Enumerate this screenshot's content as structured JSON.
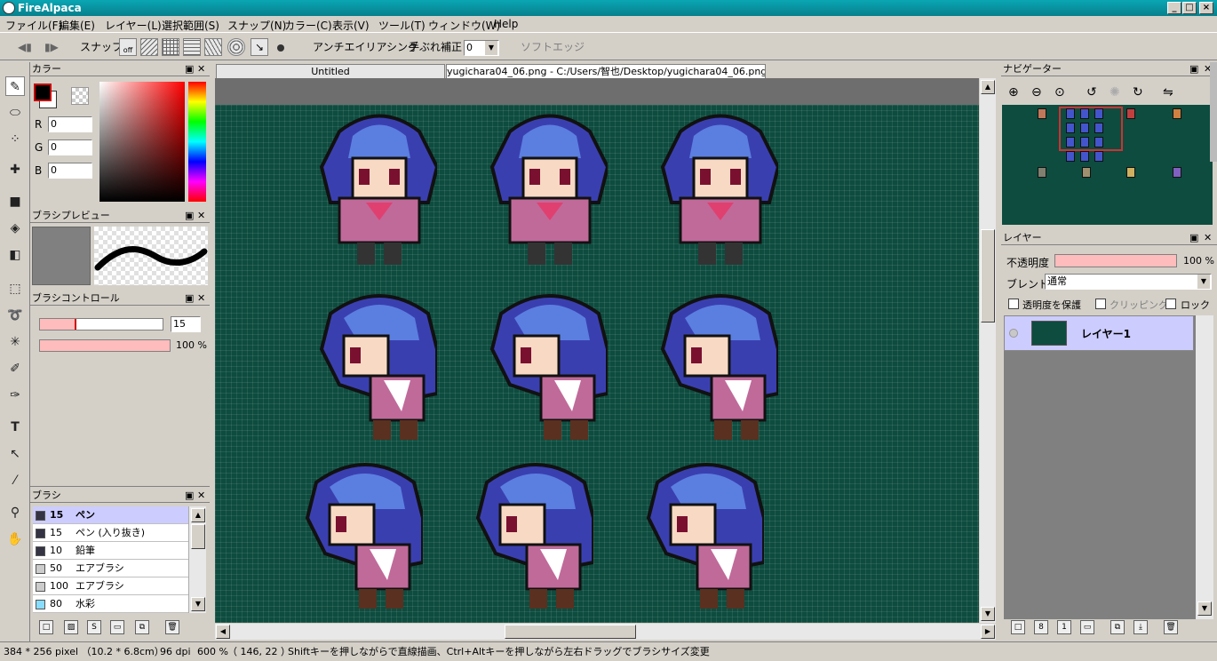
{
  "window": {
    "title": "FireAlpaca"
  },
  "menu": [
    "ファイル(F)",
    "編集(E)",
    "レイヤー(L)",
    "選択範囲(S)",
    "スナップ(N)",
    "カラー(C)",
    "表示(V)",
    "ツール(T)",
    "ウィンドウ(W)",
    "Help"
  ],
  "toolbar": {
    "snap_label": "スナップ",
    "snap_off": "off",
    "antialias_label": "アンチエイリアシング",
    "antialias_checked": "✓",
    "stabilizer_label": "手ぶれ補正",
    "stabilizer_value": "0",
    "soft_edge_label": "ソフトエッジ"
  },
  "tabs": [
    {
      "label": "Untitled"
    },
    {
      "label": "yugichara04_06.png - C:/Users/智也/Desktop/yugichara04_06.png"
    }
  ],
  "color_panel": {
    "title": "カラー",
    "r_label": "R",
    "r_value": "0",
    "g_label": "G",
    "g_value": "0",
    "b_label": "B",
    "b_value": "0",
    "fg_color": "#000000",
    "bg_color": "#ffffff"
  },
  "brush_preview": {
    "title": "ブラシプレビュー"
  },
  "brush_control": {
    "title": "ブラシコントロール",
    "size_value": "15",
    "opacity_value": "100 %"
  },
  "brush_panel": {
    "title": "ブラシ",
    "items": [
      {
        "size": "15",
        "name": "ペン",
        "swatch": "#333344",
        "selected": true
      },
      {
        "size": "15",
        "name": "ペン (入り抜き)",
        "swatch": "#333344",
        "selected": false
      },
      {
        "size": "10",
        "name": "鉛筆",
        "swatch": "#333344",
        "selected": false
      },
      {
        "size": "50",
        "name": "エアブラシ",
        "swatch": "#cccccc",
        "selected": false
      },
      {
        "size": "100",
        "name": "エアブラシ",
        "swatch": "#cccccc",
        "selected": false
      },
      {
        "size": "80",
        "name": "水彩",
        "swatch": "#88ddff",
        "selected": false
      }
    ]
  },
  "navigator": {
    "title": "ナビゲーター"
  },
  "layer_panel": {
    "title": "レイヤー",
    "opacity_label": "不透明度",
    "opacity_value": "100 %",
    "blend_label": "ブレンド",
    "blend_value": "通常",
    "protect_alpha_label": "透明度を保護",
    "clipping_label": "クリッピング",
    "lock_label": "ロック",
    "layers": [
      {
        "name": "レイヤー1"
      }
    ]
  },
  "status": {
    "size": "384 * 256 pixel （10.2 * 6.8cm）",
    "dpi": "96 dpi",
    "zoom": "600 %",
    "coords": "（ 146, 22 ）",
    "hint": "Shiftキーを押しながらで直線描画、Ctrl+Altキーを押しながら左右ドラッグでブラシサイズ変更"
  },
  "colors": {
    "canvas_bg": "#0d4c3f",
    "title_bar": "#0aa6b4",
    "accent_pink": "#ffbcbc",
    "selection": "#ccccff"
  }
}
